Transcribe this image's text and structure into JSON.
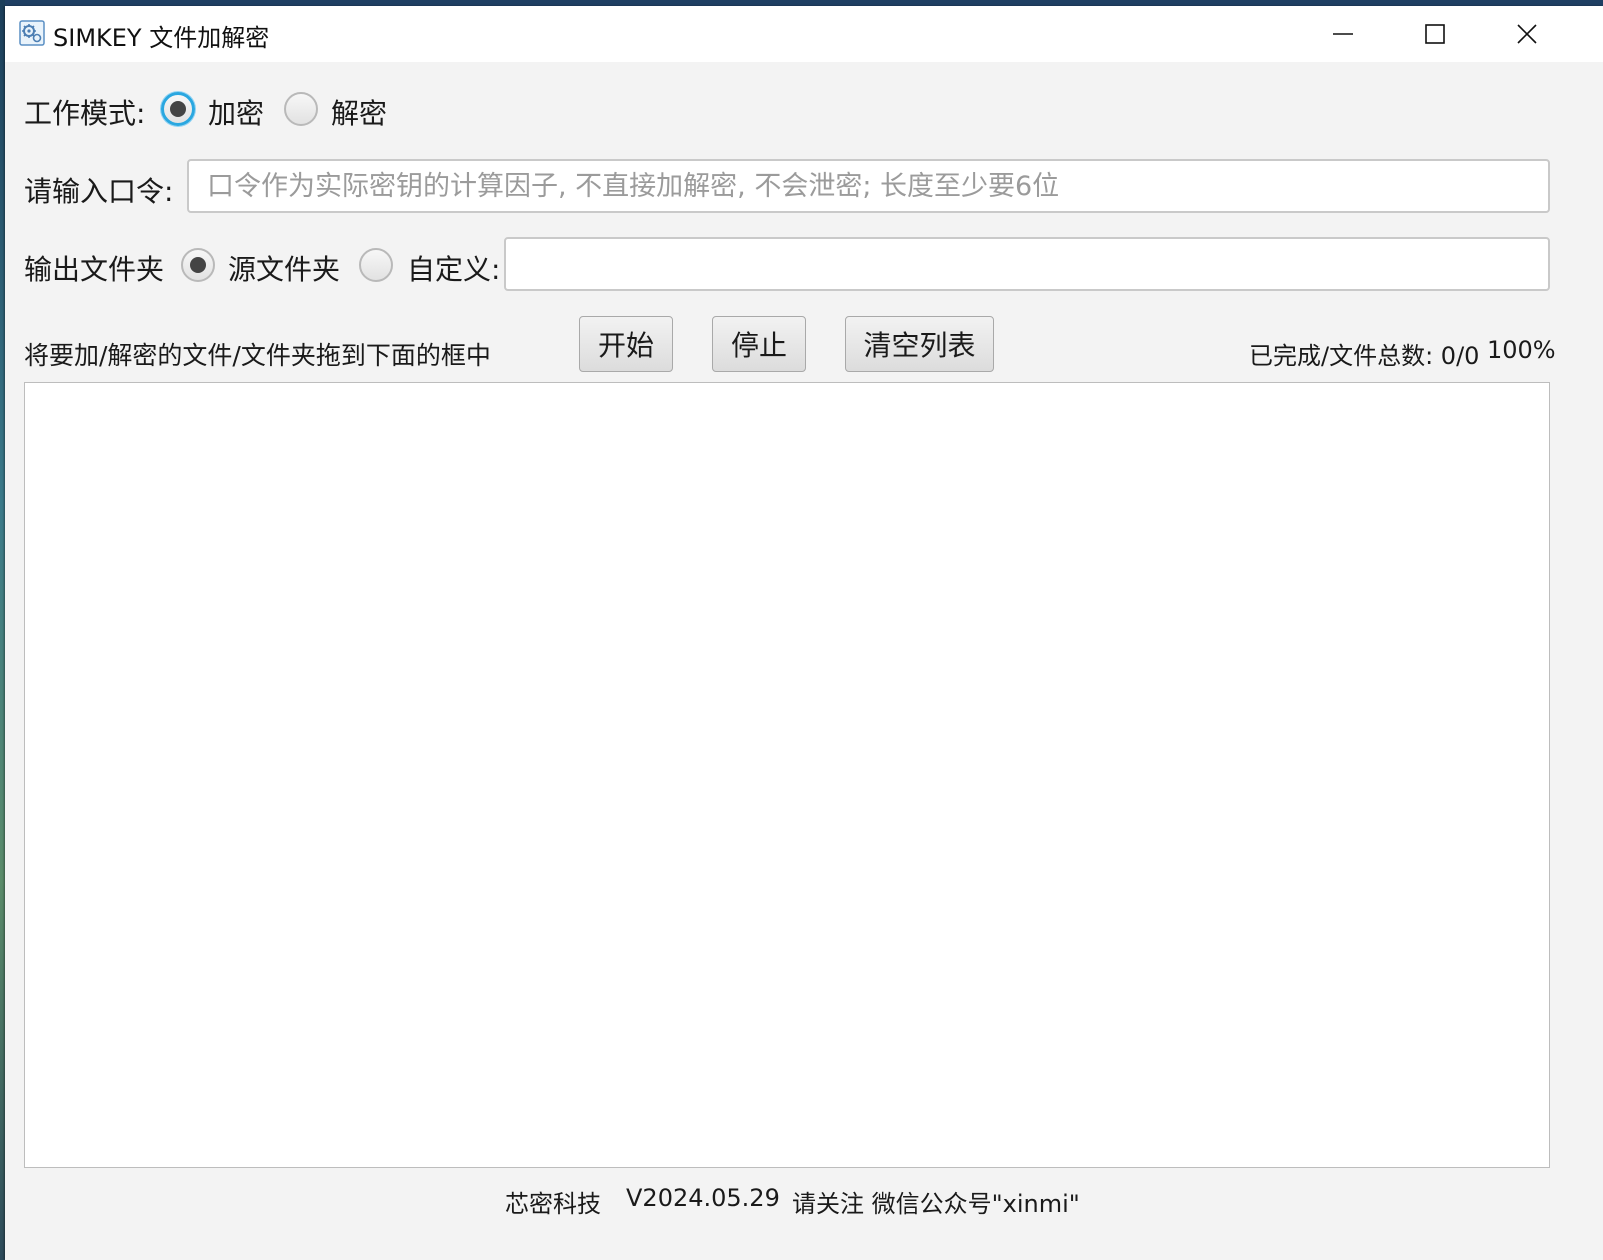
{
  "window": {
    "title": "SIMKEY 文件加解密",
    "icon": "gear-cog-app-icon"
  },
  "mode": {
    "label": "工作模式:",
    "options": [
      {
        "label": "加密",
        "selected": true
      },
      {
        "label": "解密",
        "selected": false
      }
    ]
  },
  "password": {
    "label": "请输入口令:",
    "placeholder": "口令作为实际密钥的计算因子, 不直接加解密, 不会泄密; 长度至少要6位",
    "value": ""
  },
  "output": {
    "label": "输出文件夹",
    "options": [
      {
        "label": "源文件夹",
        "selected": true
      },
      {
        "label": "自定义:",
        "selected": false
      }
    ],
    "custom_path": ""
  },
  "actions": {
    "hint": "将要加/解密的文件/文件夹拖到下面的框中",
    "start_label": "开始",
    "stop_label": "停止",
    "clear_label": "清空列表",
    "progress_text": "已完成/文件总数: 0/0",
    "percent_text": "100%"
  },
  "footer": {
    "company": "芯密科技",
    "version": "V2024.05.29",
    "follow": "请关注 微信公众号\"xinmi\""
  },
  "colors": {
    "window_bg": "#f3f3f3",
    "focus_ring": "#2aa7e0",
    "radio_dot": "#444444"
  }
}
